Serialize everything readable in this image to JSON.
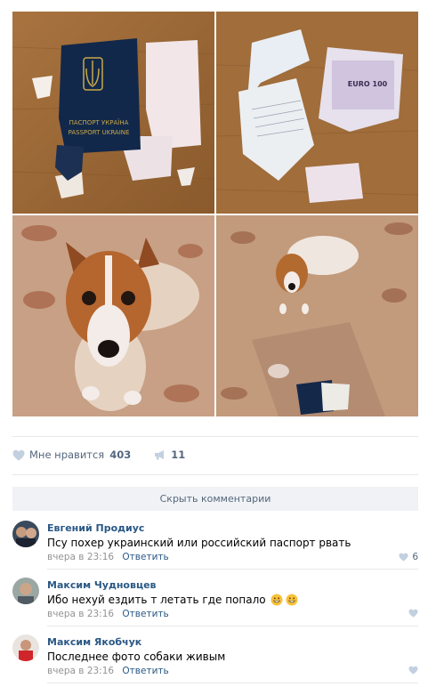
{
  "photos": [
    {
      "alt": "torn-passport-photo"
    },
    {
      "alt": "torn-documents-photo"
    },
    {
      "alt": "dog-closeup-photo"
    },
    {
      "alt": "dog-with-passport-photo"
    }
  ],
  "photo_text": {
    "passport_line1": "ПАСПОРТ УКРАЇНА",
    "passport_line2": "PASSPORT UKRAINE",
    "banknote": "EURO 100"
  },
  "stats": {
    "like_label": "Мне нравится",
    "like_count": "403",
    "share_count": "11"
  },
  "hide_comments_label": "Скрыть комментарии",
  "comments": [
    {
      "author": "Евгений Продиус",
      "text": "Псу похер украинский или российский паспорт рвать",
      "time": "вчера в 23:16",
      "reply": "Ответить",
      "likes": "6"
    },
    {
      "author": "Максим Чудновцев",
      "text": "Ибо нехуй ездить т летать где попало",
      "time": "вчера в 23:16",
      "reply": "Ответить",
      "likes": ""
    },
    {
      "author": "Максим Якобчук",
      "text": "Последнее фото собаки живым",
      "time": "вчера в 23:16",
      "reply": "Ответить",
      "likes": ""
    }
  ],
  "colors": {
    "link": "#2a5885",
    "muted": "#939393",
    "stat": "#55677d",
    "button_bg": "#f0f2f5"
  }
}
